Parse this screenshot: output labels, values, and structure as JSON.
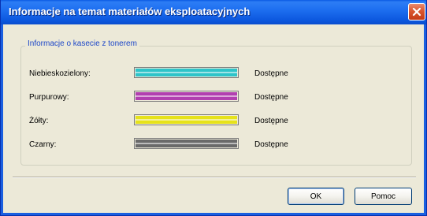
{
  "window": {
    "title": "Informacje na temat materiałów eksploatacyjnych"
  },
  "group": {
    "title": "Informacje o kasecie z tonerem"
  },
  "toners": [
    {
      "label": "Niebieskozielony:",
      "status": "Dostępne",
      "color": "#2ec4c9",
      "level": 1.0
    },
    {
      "label": "Purpurowy:",
      "status": "Dostępne",
      "color": "#b13fb0",
      "level": 1.0
    },
    {
      "label": "Żółty:",
      "status": "Dostępne",
      "color": "#e6e21a",
      "level": 1.0
    },
    {
      "label": "Czarny:",
      "status": "Dostępne",
      "color": "#6a6a6a",
      "level": 1.0
    }
  ],
  "buttons": {
    "ok_label": "OK",
    "help_label": "Pomoc"
  },
  "icons": {
    "close": "close-icon"
  }
}
